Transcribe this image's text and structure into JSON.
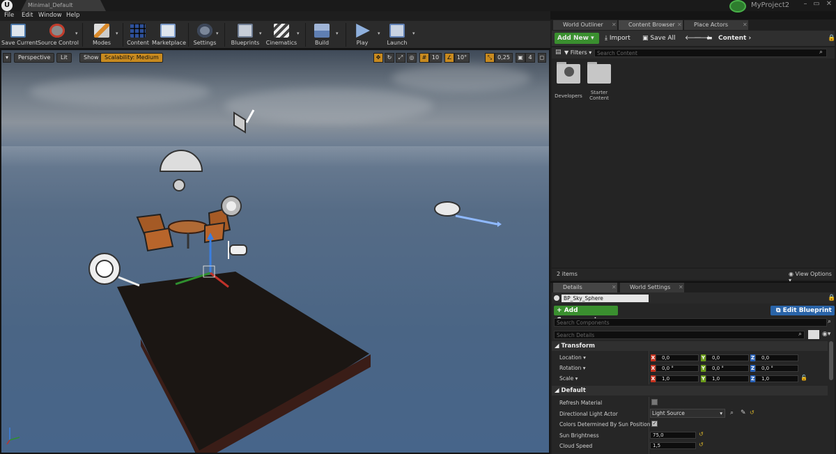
{
  "window": {
    "tab_title": "Minimal_Default",
    "project_name": "MyProject2",
    "logo_text": "U",
    "controls": [
      "–",
      "▭",
      "✕"
    ]
  },
  "menu": [
    "File",
    "Edit",
    "Window",
    "Help"
  ],
  "toolbar": {
    "items": [
      {
        "label": "Save Current",
        "icon": "save-icon"
      },
      {
        "label": "Source Control",
        "icon": "source-control-icon"
      },
      {
        "label": "Modes",
        "icon": "modes-icon"
      },
      {
        "label": "Content",
        "icon": "content-icon"
      },
      {
        "label": "Marketplace",
        "icon": "marketplace-icon"
      },
      {
        "label": "Settings",
        "icon": "settings-icon"
      },
      {
        "label": "Blueprints",
        "icon": "blueprints-icon"
      },
      {
        "label": "Cinematics",
        "icon": "cinematics-icon"
      },
      {
        "label": "Build",
        "icon": "build-icon"
      },
      {
        "label": "Play",
        "icon": "play-icon"
      },
      {
        "label": "Launch",
        "icon": "launch-icon"
      }
    ],
    "dropdown_glyph": "▾"
  },
  "viewport": {
    "menu_glyph": "▾",
    "perspective": "Perspective",
    "lit": "Lit",
    "show": "Show",
    "scalability": "Scalability: Medium",
    "grid_snap": "10",
    "rotation_snap": "10°",
    "scale_snap": "0,25",
    "camera_speed": "4",
    "axis_labels": {
      "x": "X",
      "y": "Y",
      "z": "Z"
    }
  },
  "panels": {
    "top_tabs": [
      "World Outliner",
      "Content Browser",
      "Place Actors"
    ],
    "content_browser": {
      "add_new": "Add New",
      "import": "Import",
      "save_all": "Save All",
      "path": "Content",
      "filters": "Filters",
      "search_placeholder": "Search Content",
      "folders": [
        {
          "name": "Developers"
        },
        {
          "name": "Starter Content"
        }
      ],
      "item_count": "2 items",
      "view_options": "View Options"
    },
    "bottom_tabs": [
      "Details",
      "World Settings"
    ],
    "details": {
      "actor_name": "BP_Sky_Sphere",
      "add_component": "Add Component",
      "edit_blueprint": "Edit Blueprint",
      "search_components_placeholder": "Search Components",
      "search_details_placeholder": "Search Details",
      "transform_title": "Transform",
      "transform": [
        {
          "label": "Location",
          "x": "0,0",
          "y": "0,0",
          "z": "0,0"
        },
        {
          "label": "Rotation",
          "x": "0,0 °",
          "y": "0,0 °",
          "z": "0,0 °"
        },
        {
          "label": "Scale",
          "x": "1,0",
          "y": "1,0",
          "z": "1,0"
        }
      ],
      "default_title": "Default",
      "properties": [
        {
          "label": "Refresh Material",
          "type": "checkbox",
          "checked": false
        },
        {
          "label": "Directional Light Actor",
          "type": "select",
          "value": "Light Source"
        },
        {
          "label": "Colors Determined By Sun Position",
          "type": "checkbox",
          "checked": true
        },
        {
          "label": "Sun Brightness",
          "type": "number",
          "value": "75,0"
        },
        {
          "label": "Cloud Speed",
          "type": "number",
          "value": "1,5"
        }
      ]
    }
  },
  "colors": {
    "accent_green": "#3a8f2f",
    "accent_blue": "#2a64a8",
    "scalability_yellow": "#c88a1f",
    "axis_x": "#c6331f",
    "axis_y": "#6a9a1a",
    "axis_z": "#2a62b8"
  }
}
